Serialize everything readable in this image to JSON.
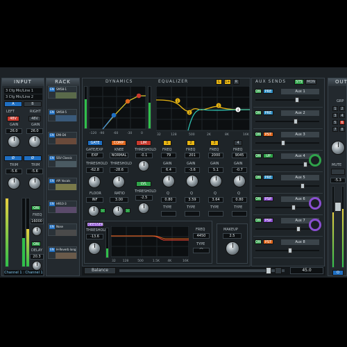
{
  "input": {
    "title": "INPUT",
    "device1": "3 Cfg Mic/Line 1",
    "device2": "3 Cfg Mic/Line 2",
    "a": "A",
    "b": "B",
    "left": "LEFT",
    "right": "RIGHT",
    "v48": "48V",
    "gain": "GAIN",
    "gain_l": "26.0",
    "gain_r": "26.0",
    "trim": "TRIM",
    "trim_l": "-5.6",
    "trim_r": "-5.6",
    "freq": "FREQ",
    "freq_l": "16000",
    "freq_r": "16000",
    "delay": "DELAY",
    "delay_val": "20.3",
    "on": "ON",
    "channel": "Channel 1 : Channel 1"
  },
  "rack": {
    "title": "RACK",
    "slots": [
      {
        "en": "EN",
        "name": "SM58-1"
      },
      {
        "en": "EN",
        "name": "SM58-5"
      },
      {
        "en": "EN",
        "name": "EMI-D4"
      },
      {
        "en": "EN",
        "name": "SSV Classic"
      },
      {
        "en": "EN",
        "name": "API Vocals"
      },
      {
        "en": "EN",
        "name": "H910-3"
      },
      {
        "en": "EN",
        "name": "Nose"
      },
      {
        "en": "EN",
        "name": "H-Reverb long"
      }
    ]
  },
  "dynamics": {
    "title": "DYNAMICS",
    "gate": "GATE",
    "gate_exp": "GATE/EXP",
    "exp": "EXP",
    "comp": "COMP",
    "knee": "KNEE",
    "normal": "NORMAL",
    "lim": "LIM",
    "threshold": "THRESHOLD",
    "gate_thr": "-62.8",
    "comp_thr": "-28.6",
    "lim_thr": "-0.1",
    "floor": "FLOOR",
    "floor_val": "INF",
    "ratio": "RATIO",
    "ratio_val": "3.00",
    "lvl": "LVL",
    "lvl_thr": "-2.5",
    "ax": [
      "-120",
      "-90",
      "-60",
      "-30",
      "0"
    ]
  },
  "deesser": {
    "label": "DEESSER",
    "threshold": "THRESHOLD",
    "thr_val": "-13.6",
    "freq": "FREQ",
    "freq_val": "4450",
    "type": "TYPE",
    "ticks": [
      "32",
      "128",
      "500",
      "1.5K",
      "4K",
      "16K"
    ]
  },
  "eq": {
    "title": "EQUALIZER",
    "l": "L",
    "lr": "L+",
    "r": "R",
    "ticks": [
      "32",
      "128",
      "500",
      "2K",
      "8K",
      "16K"
    ],
    "bands": [
      {
        "n": "1",
        "freq": "79",
        "gain": "6.4",
        "q": "0.80"
      },
      {
        "n": "2",
        "freq": "201",
        "gain": "-3.6",
        "q": "3.59"
      },
      {
        "n": "3",
        "freq": "2000",
        "gain": "5.1",
        "q": "3.64"
      },
      {
        "n": "4",
        "freq": "9045",
        "gain": "-0.7",
        "q": "0.80"
      }
    ],
    "freq": "FREQ",
    "gain": "GAIN",
    "q": "Q",
    "type": "TYPE",
    "makeup": "MAKEUP",
    "makeup_val": "2.5"
  },
  "aux": {
    "title": "AUX SENDS",
    "sts": "STS",
    "mon": "MON",
    "sends": [
      {
        "on": "ON",
        "mode": "PRE",
        "name": "Aux 1"
      },
      {
        "on": "ON",
        "mode": "PRE",
        "name": "Aux 2"
      },
      {
        "on": "ON",
        "mode": "PST",
        "name": "Aux 3"
      },
      {
        "on": "ON",
        "mode": "UP",
        "name": "Aux 4"
      },
      {
        "on": "ON",
        "mode": "PRE",
        "name": "Aux 5"
      },
      {
        "on": "ON",
        "mode": "PSP",
        "name": "Aux 6"
      },
      {
        "on": "ON",
        "mode": "PSP",
        "name": "Aux 7"
      },
      {
        "on": "ON",
        "mode": "PST",
        "name": "Aux 8"
      }
    ]
  },
  "output": {
    "title": "OUT",
    "grp": "GRP",
    "mute": "MUTE",
    "level": "-5.3",
    "o": "O"
  },
  "bottom": {
    "balance": "Balance",
    "pan_val": "45.0"
  },
  "colors": {
    "accent": "#e8b512",
    "green": "#2fa34a",
    "blue": "#1f6fc2",
    "purple": "#8a4fd0"
  }
}
